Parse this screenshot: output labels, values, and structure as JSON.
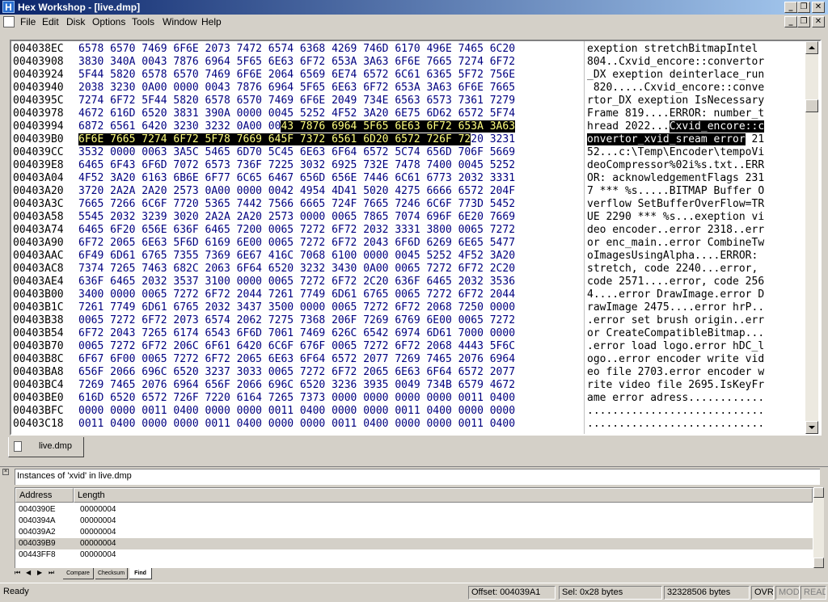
{
  "window": {
    "title": "Hex Workshop - [live.dmp]"
  },
  "menu": [
    "File",
    "Edit",
    "Disk",
    "Options",
    "Tools",
    "Window",
    "Help"
  ],
  "hex": {
    "rows": [
      {
        "addr": "004038EC",
        "hex": "6578 6570 7469 6F6E 2073 7472 6574 6368 4269 746D 6170 496E 7465 6C20",
        "ascii": "exeption stretchBitmapIntel"
      },
      {
        "addr": "00403908",
        "hex": "3830 340A 0043 7876 6964 5F65 6E63 6F72 653A 3A63 6F6E 7665 7274 6F72",
        "ascii": "804..Cxvid_encore::convertor"
      },
      {
        "addr": "00403924",
        "hex": "5F44 5820 6578 6570 7469 6F6E 2064 6569 6E74 6572 6C61 6365 5F72 756E",
        "ascii": "_DX exeption deinterlace_run"
      },
      {
        "addr": "00403940",
        "hex": "2038 3230 0A00 0000 0043 7876 6964 5F65 6E63 6F72 653A 3A63 6F6E 7665",
        "ascii": " 820.....Cxvid_encore::conve"
      },
      {
        "addr": "0040395C",
        "hex": "7274 6F72 5F44 5820 6578 6570 7469 6F6E 2049 734E 6563 6573 7361 7279",
        "ascii": "rtor_DX exeption IsNecessary"
      },
      {
        "addr": "00403978",
        "hex": "4672 616D 6520 3831 390A 0000 0045 5252 4F52 3A20 6E75 6D62 6572 5F74",
        "ascii": "Frame 819....ERROR: number_t"
      },
      {
        "addr": "00403994",
        "hex": "6872 6561 6420 3230 3232 0A00 00",
        "hexhl": "43 7876 6964 5F65 6E63 6F72 653A 3A63",
        "hexpost": "",
        "ascii": "hread 2022...",
        "asciihl": "Cxvid_encore::c",
        "asciipost": ""
      },
      {
        "addr": "004039B0",
        "hex": "",
        "hexhl": "6F6E 7665 7274 6F72 5F78 7669 645F 7372 6561 6D20 6572 726F 72",
        "hexpost": "20 3231",
        "ascii": "",
        "asciihl": "onvertor_xvid_sream error",
        "asciipost": " 21"
      },
      {
        "addr": "004039CC",
        "hex": "3532 0000 0063 3A5C 5465 6D70 5C45 6E63 6F64 6572 5C74 656D 706F 5669",
        "ascii": "52...c:\\Temp\\Encoder\\tempoVi"
      },
      {
        "addr": "004039E8",
        "hex": "6465 6F43 6F6D 7072 6573 736F 7225 3032 6925 732E 7478 7400 0045 5252",
        "ascii": "deoCompressor%02i%s.txt..ERR"
      },
      {
        "addr": "00403A04",
        "hex": "4F52 3A20 6163 6B6E 6F77 6C65 6467 656D 656E 7446 6C61 6773 2032 3331",
        "ascii": "OR: acknowledgementFlags 231"
      },
      {
        "addr": "00403A20",
        "hex": "3720 2A2A 2A20 2573 0A00 0000 0042 4954 4D41 5020 4275 6666 6572 204F",
        "ascii": "7 *** %s.....BITMAP Buffer O"
      },
      {
        "addr": "00403A3C",
        "hex": "7665 7266 6C6F 7720 5365 7442 7566 6665 724F 7665 7246 6C6F 773D 5452",
        "ascii": "verflow SetBufferOverFlow=TR"
      },
      {
        "addr": "00403A58",
        "hex": "5545 2032 3239 3020 2A2A 2A20 2573 0000 0065 7865 7074 696F 6E20 7669",
        "ascii": "UE 2290 *** %s...exeption vi"
      },
      {
        "addr": "00403A74",
        "hex": "6465 6F20 656E 636F 6465 7200 0065 7272 6F72 2032 3331 3800 0065 7272",
        "ascii": "deo encoder..error 2318..err"
      },
      {
        "addr": "00403A90",
        "hex": "6F72 2065 6E63 5F6D 6169 6E00 0065 7272 6F72 2043 6F6D 6269 6E65 5477",
        "ascii": "or enc_main..error CombineTw"
      },
      {
        "addr": "00403AAC",
        "hex": "6F49 6D61 6765 7355 7369 6E67 416C 7068 6100 0000 0045 5252 4F52 3A20",
        "ascii": "oImagesUsingAlpha....ERROR: "
      },
      {
        "addr": "00403AC8",
        "hex": "7374 7265 7463 682C 2063 6F64 6520 3232 3430 0A00 0065 7272 6F72 2C20",
        "ascii": "stretch, code 2240...error, "
      },
      {
        "addr": "00403AE4",
        "hex": "636F 6465 2032 3537 3100 0000 0065 7272 6F72 2C20 636F 6465 2032 3536",
        "ascii": "code 2571....error, code 256"
      },
      {
        "addr": "00403B00",
        "hex": "3400 0000 0065 7272 6F72 2044 7261 7749 6D61 6765 0065 7272 6F72 2044",
        "ascii": "4....error DrawImage.error D"
      },
      {
        "addr": "00403B1C",
        "hex": "7261 7749 6D61 6765 2032 3437 3500 0000 0065 7272 6F72 2068 7250 0000",
        "ascii": "rawImage 2475....error hrP.."
      },
      {
        "addr": "00403B38",
        "hex": "0065 7272 6F72 2073 6574 2062 7275 7368 206F 7269 6769 6E00 0065 7272",
        "ascii": ".error set brush origin..err"
      },
      {
        "addr": "00403B54",
        "hex": "6F72 2043 7265 6174 6543 6F6D 7061 7469 626C 6542 6974 6D61 7000 0000",
        "ascii": "or CreateCompatibleBitmap..."
      },
      {
        "addr": "00403B70",
        "hex": "0065 7272 6F72 206C 6F61 6420 6C6F 676F 0065 7272 6F72 2068 4443 5F6C",
        "ascii": ".error load logo.error hDC_l"
      },
      {
        "addr": "00403B8C",
        "hex": "6F67 6F00 0065 7272 6F72 2065 6E63 6F64 6572 2077 7269 7465 2076 6964",
        "ascii": "ogo..error encoder write vid"
      },
      {
        "addr": "00403BA8",
        "hex": "656F 2066 696C 6520 3237 3033 0065 7272 6F72 2065 6E63 6F64 6572 2077",
        "ascii": "eo file 2703.error encoder w"
      },
      {
        "addr": "00403BC4",
        "hex": "7269 7465 2076 6964 656F 2066 696C 6520 3236 3935 0049 734B 6579 4672",
        "ascii": "rite video file 2695.IsKeyFr"
      },
      {
        "addr": "00403BE0",
        "hex": "616D 6520 6572 726F 7220 6164 7265 7373 0000 0000 0000 0000 0011 0400",
        "ascii": "ame error adress............"
      },
      {
        "addr": "00403BFC",
        "hex": "0000 0000 0011 0400 0000 0000 0011 0400 0000 0000 0011 0400 0000 0000",
        "ascii": "............................"
      },
      {
        "addr": "00403C18",
        "hex": "0011 0400 0000 0000 0011 0400 0000 0000 0011 0400 0000 0000 0011 0400",
        "ascii": "............................"
      }
    ]
  },
  "doc_tab": {
    "label": "live.dmp"
  },
  "find": {
    "header": "Instances of 'xvid' in live.dmp",
    "columns": [
      "Address",
      "Length"
    ],
    "rows": [
      {
        "address": "0040390E",
        "length": "00000004"
      },
      {
        "address": "0040394A",
        "length": "00000004"
      },
      {
        "address": "004039A2",
        "length": "00000004"
      },
      {
        "address": "004039B9",
        "length": "00000004",
        "selected": true
      },
      {
        "address": "00443FF8",
        "length": "00000004"
      }
    ]
  },
  "bottom_tabs": [
    "Compare",
    "Checksum",
    "Find"
  ],
  "status": {
    "ready": "Ready",
    "offset": "Offset: 004039A1",
    "sel": "Sel: 0x28 bytes",
    "size": "32328506 bytes",
    "ovr": "OVR",
    "mod": "MOD",
    "read": "READ"
  }
}
